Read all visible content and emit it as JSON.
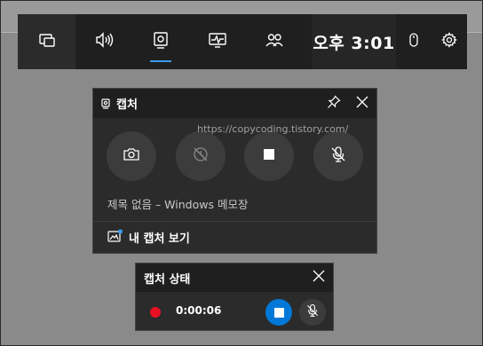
{
  "gamebar": {
    "widgets": [
      {
        "name": "widget-menu",
        "icon": "widget-menu-icon"
      },
      {
        "name": "audio",
        "icon": "speaker-icon"
      },
      {
        "name": "capture",
        "icon": "capture-icon",
        "active": true
      },
      {
        "name": "performance",
        "icon": "performance-icon"
      },
      {
        "name": "social",
        "icon": "people-icon"
      }
    ],
    "clock": "오후 3:01",
    "mouse_icon": "mouse-icon",
    "settings_icon": "gear-icon",
    "accent_color": "#3a9bef"
  },
  "capture_widget": {
    "title": "캡처",
    "pin_icon": "pin-icon",
    "close_icon": "close-icon",
    "buttons": [
      {
        "name": "screenshot",
        "icon": "camera-icon"
      },
      {
        "name": "record-last",
        "icon": "record-last-icon"
      },
      {
        "name": "record-stop",
        "icon": "stop-icon"
      },
      {
        "name": "mic-mute",
        "icon": "mic-muted-icon"
      }
    ],
    "target_window": "제목 없음 – Windows 메모장",
    "gallery_label": "내 캡처 보기"
  },
  "watermark": "https://copycoding.tistory.com/",
  "capture_status": {
    "title": "캡처 상태",
    "timer": "0:00:06",
    "recording_color": "#e81123",
    "stop_color": "#0078d7"
  }
}
